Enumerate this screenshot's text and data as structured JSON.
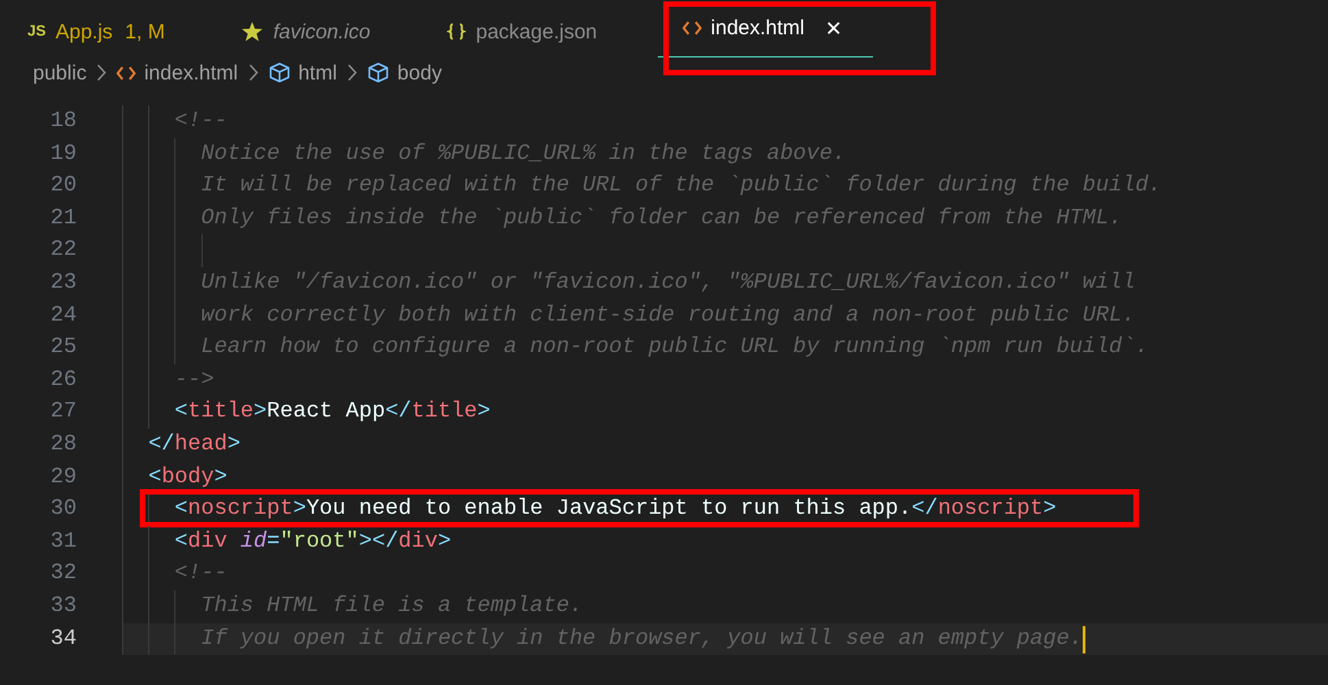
{
  "tabs": [
    {
      "label": "App.js",
      "kind": "js",
      "icon_text": "JS",
      "badge": "1, M",
      "modified": true,
      "preview": false,
      "selected": false,
      "highlighted": false
    },
    {
      "label": "favicon.ico",
      "kind": "image",
      "modified": false,
      "preview": true,
      "selected": false,
      "highlighted": false
    },
    {
      "label": "package.json",
      "kind": "json",
      "modified": false,
      "preview": false,
      "selected": false,
      "highlighted": false
    },
    {
      "label": "index.html",
      "kind": "html",
      "close": "✕",
      "modified": false,
      "preview": false,
      "selected": true,
      "highlighted": true
    }
  ],
  "breadcrumb": [
    {
      "label": "public",
      "kind": "folder"
    },
    {
      "label": "index.html",
      "kind": "html"
    },
    {
      "label": "html",
      "kind": "element"
    },
    {
      "label": "body",
      "kind": "element"
    }
  ],
  "lines": [
    {
      "number": "18",
      "tokens": [
        {
          "kind": "comment",
          "text": "    <!--"
        }
      ]
    },
    {
      "number": "19",
      "tokens": [
        {
          "kind": "comment",
          "text": "      Notice the use of %PUBLIC_URL% in the tags above."
        }
      ]
    },
    {
      "number": "20",
      "tokens": [
        {
          "kind": "comment",
          "text": "      It will be replaced with the URL of the `public` folder during the build."
        }
      ]
    },
    {
      "number": "21",
      "tokens": [
        {
          "kind": "comment",
          "text": "      Only files inside the `public` folder can be referenced from the HTML."
        }
      ]
    },
    {
      "number": "22"
    },
    {
      "number": "23",
      "tokens": [
        {
          "kind": "comment",
          "text": "      Unlike \"/favicon.ico\" or \"favicon.ico\", \"%PUBLIC_URL%/favicon.ico\" will"
        }
      ]
    },
    {
      "number": "24",
      "tokens": [
        {
          "kind": "comment",
          "text": "      work correctly both with client-side routing and a non-root public URL."
        }
      ]
    },
    {
      "number": "25",
      "tokens": [
        {
          "kind": "comment",
          "text": "      Learn how to configure a non-root public URL by running `npm run build`."
        }
      ]
    },
    {
      "number": "26",
      "tokens": [
        {
          "kind": "comment",
          "text": "    -->"
        }
      ]
    },
    {
      "number": "27",
      "tokens": [
        {
          "kind": "punct",
          "text": "    <"
        },
        {
          "kind": "tag",
          "text": "title"
        },
        {
          "kind": "punct",
          "text": ">"
        },
        {
          "kind": "text",
          "text": "React App"
        },
        {
          "kind": "punct",
          "text": "</"
        },
        {
          "kind": "tag",
          "text": "title"
        },
        {
          "kind": "punct",
          "text": ">"
        }
      ]
    },
    {
      "number": "28",
      "tokens": [
        {
          "kind": "punct",
          "text": "  </"
        },
        {
          "kind": "tag",
          "text": "head"
        },
        {
          "kind": "punct",
          "text": ">"
        }
      ]
    },
    {
      "number": "29",
      "tokens": [
        {
          "kind": "punct",
          "text": "  <"
        },
        {
          "kind": "tag",
          "text": "body"
        },
        {
          "kind": "punct",
          "text": ">"
        }
      ]
    },
    {
      "number": "30",
      "highlighted": true,
      "tokens": [
        {
          "kind": "punct",
          "text": "    <"
        },
        {
          "kind": "tag",
          "text": "noscript"
        },
        {
          "kind": "punct",
          "text": ">"
        },
        {
          "kind": "text",
          "text": "You need to enable JavaScript to run this app."
        },
        {
          "kind": "punct",
          "text": "</"
        },
        {
          "kind": "tag",
          "text": "noscript"
        },
        {
          "kind": "punct",
          "text": ">"
        }
      ]
    },
    {
      "number": "31",
      "tokens": [
        {
          "kind": "punct",
          "text": "    <"
        },
        {
          "kind": "tag",
          "text": "div"
        },
        {
          "kind": "attr",
          "text": " id"
        },
        {
          "kind": "punct",
          "text": "="
        },
        {
          "kind": "string",
          "text": "\"root\""
        },
        {
          "kind": "punct",
          "text": "></"
        },
        {
          "kind": "tag",
          "text": "div"
        },
        {
          "kind": "punct",
          "text": ">"
        }
      ]
    },
    {
      "number": "32",
      "tokens": [
        {
          "kind": "comment",
          "text": "    <!--"
        }
      ]
    },
    {
      "number": "33",
      "tokens": [
        {
          "kind": "comment",
          "text": "      This HTML file is a template."
        }
      ]
    },
    {
      "number": "34",
      "current": true,
      "tokens": [
        {
          "kind": "comment",
          "text": "      If you open it directly in the browser, you will see an empty page."
        }
      ]
    }
  ]
}
